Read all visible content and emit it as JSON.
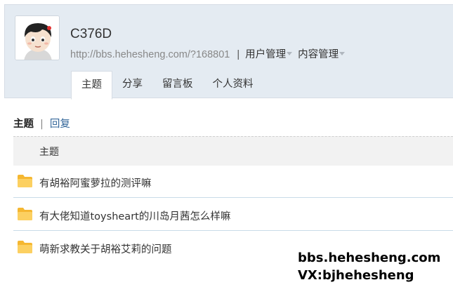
{
  "profile": {
    "username": "C376D",
    "url": "http://bbs.hehesheng.com/?168801",
    "separator": "|",
    "menus": [
      "用户管理",
      "内容管理"
    ]
  },
  "tabs": [
    {
      "label": "主题",
      "active": true
    },
    {
      "label": "分享",
      "active": false
    },
    {
      "label": "留言板",
      "active": false
    },
    {
      "label": "个人资料",
      "active": false
    }
  ],
  "subnav": {
    "current": "主题",
    "separator": "|",
    "other": "回复"
  },
  "table": {
    "header": "主题",
    "rows": [
      {
        "title": "有胡裕阿蜜萝拉的测评嘛"
      },
      {
        "title": "有大佬知道toysheart的川岛月茜怎么样嘛"
      },
      {
        "title": "萌新求教关于胡裕艾莉的问题"
      }
    ]
  },
  "watermark": {
    "line1": "bbs.hehesheng.com",
    "line2": "VX:bjhehesheng"
  },
  "colors": {
    "header_bg": "#e4ebf2",
    "link": "#336699",
    "folder": "#f5b731",
    "row_border": "#c9dbe8"
  }
}
